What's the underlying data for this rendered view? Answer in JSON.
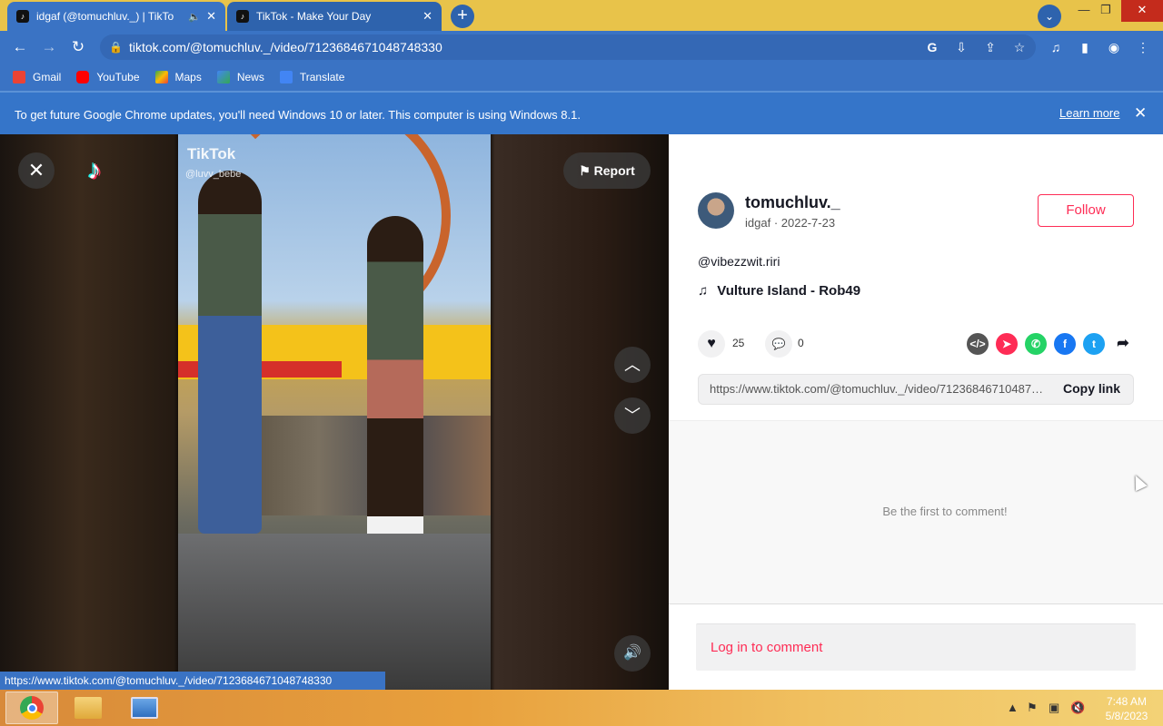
{
  "tabs": [
    {
      "title": "idgaf (@tomuchluv._) | TikTo",
      "active": true
    },
    {
      "title": "TikTok - Make Your Day",
      "active": false
    }
  ],
  "address_bar": {
    "url": "tiktok.com/@tomuchluv._/video/7123684671048748330"
  },
  "bookmarks": [
    {
      "label": "Gmail",
      "icon": "gmail-icon",
      "color": "#ea4335"
    },
    {
      "label": "YouTube",
      "icon": "youtube-icon",
      "color": "#ff0000"
    },
    {
      "label": "Maps",
      "icon": "maps-icon",
      "color": "#34a853"
    },
    {
      "label": "News",
      "icon": "news-icon",
      "color": "#4285f4"
    },
    {
      "label": "Translate",
      "icon": "translate-icon",
      "color": "#4285f4"
    }
  ],
  "infobar": {
    "message": "To get future Google Chrome updates, you'll need Windows 10 or later. This computer is using Windows 8.1.",
    "link": "Learn more"
  },
  "video": {
    "watermark": "TikTok",
    "watermark_user": "@luvv_bebe",
    "report_label": "Report"
  },
  "post": {
    "username": "tomuchluv._",
    "nickname": "idgaf",
    "date": "2022-7-23",
    "follow_label": "Follow",
    "description": "@vibezzwit.riri",
    "music": "Vulture Island - Rob49",
    "likes": "25",
    "comments": "0",
    "share_url": "https://www.tiktok.com/@tomuchluv._/video/7123684671048748330",
    "copy_label": "Copy link",
    "empty_comments": "Be the first to comment!",
    "login_prompt": "Log in to comment"
  },
  "status_url": "https://www.tiktok.com/@tomuchluv._/video/7123684671048748330",
  "taskbar": {
    "time": "7:48 AM",
    "date": "5/8/2023"
  },
  "colors": {
    "accent": "#fe2c55",
    "chrome_blue": "#3a73c4",
    "taskbar": "#e8a03c"
  }
}
